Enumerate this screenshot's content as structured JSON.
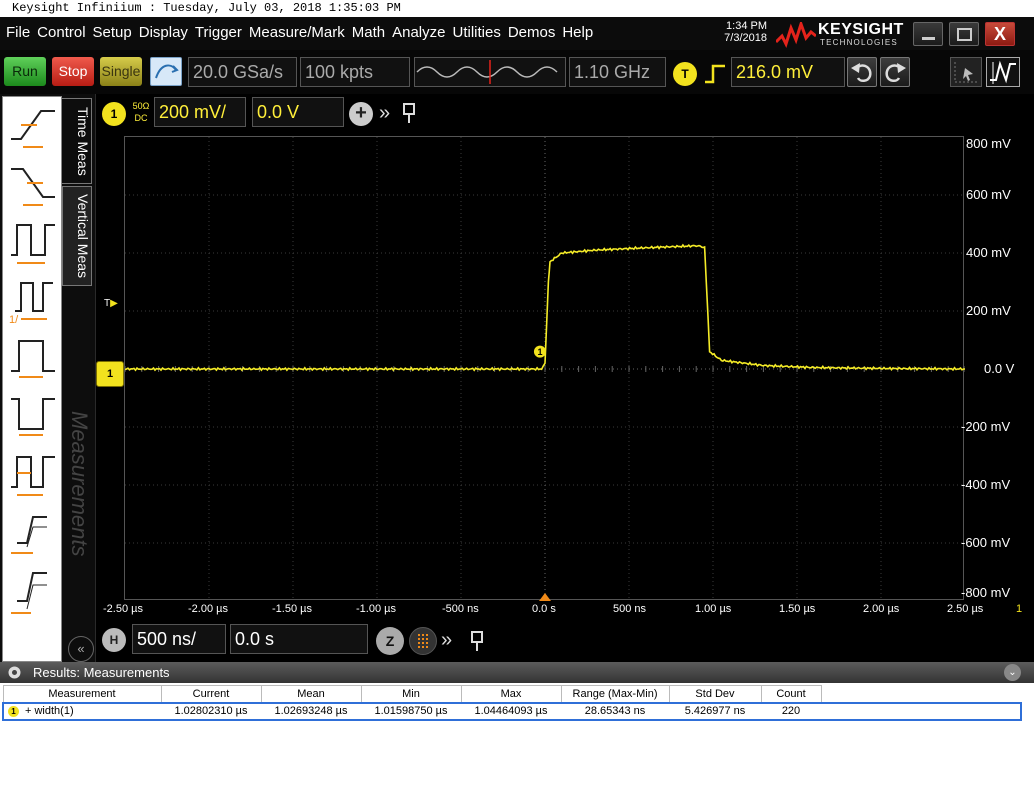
{
  "window": {
    "title": "Keysight Infiniium : Tuesday, July 03, 2018 1:35:03 PM"
  },
  "menu": [
    "File",
    "Control",
    "Setup",
    "Display",
    "Trigger",
    "Measure/Mark",
    "Math",
    "Analyze",
    "Utilities",
    "Demos",
    "Help"
  ],
  "clock": {
    "time": "1:34 PM",
    "date": "7/3/2018"
  },
  "brand": {
    "name": "KEYSIGHT",
    "sub": "TECHNOLOGIES"
  },
  "window_controls": {
    "close": "X"
  },
  "toolbar": {
    "run": "Run",
    "stop": "Stop",
    "single": "Single",
    "sample_rate": "20.0 GSa/s",
    "memory_depth": "100 kpts",
    "bandwidth": "1.10 GHz",
    "trigger_badge": "T",
    "trigger_level": "216.0 mV"
  },
  "left_tabs": {
    "time": "Time Meas",
    "vertical": "Vertical Meas",
    "watermark": "Measurements"
  },
  "channel": {
    "badge": "1",
    "coupling_1": "50Ω",
    "coupling_2": "DC",
    "scale": "200 mV/",
    "offset": "0.0 V"
  },
  "horizontal": {
    "badge": "H",
    "scale": "500 ns/",
    "position": "0.0 s",
    "zoom": "Z"
  },
  "y_axis": [
    "800 mV",
    "600 mV",
    "400 mV",
    "200 mV",
    "0.0 V",
    "-200 mV",
    "-400 mV",
    "-600 mV",
    "-800 mV"
  ],
  "x_axis": [
    "-2.50 µs",
    "-2.00 µs",
    "-1.50 µs",
    "-1.00 µs",
    "-500 ns",
    "0.0 s",
    "500 ns",
    "1.00 µs",
    "1.50 µs",
    "2.00 µs",
    "2.50 µs"
  ],
  "markers": {
    "trigger_marker": "T",
    "channel_marker": "1",
    "meas_marker": "1",
    "right_edge": "1"
  },
  "chart_data": {
    "type": "line",
    "xlim_us": [
      -2.5,
      2.5
    ],
    "ylim_mV": [
      -800,
      800
    ],
    "series": [
      {
        "x_us": [
          -2.5,
          -0.02,
          0.0,
          0.02,
          0.03,
          0.1,
          0.3,
          0.6,
          0.9,
          0.95,
          0.98,
          1.05,
          1.3,
          1.6,
          2.0,
          2.5
        ],
        "y_mV": [
          0,
          0,
          20,
          300,
          370,
          400,
          410,
          418,
          425,
          420,
          60,
          30,
          12,
          5,
          2,
          0
        ]
      }
    ],
    "grid": true,
    "color": "#f5ec27"
  },
  "results": {
    "title": "Results: Measurements",
    "columns": [
      "Measurement",
      "Current",
      "Mean",
      "Min",
      "Max",
      "Range (Max-Min)",
      "Std Dev",
      "Count"
    ],
    "rows": [
      [
        "+ width(1)",
        "1.02802310 µs",
        "1.02693248 µs",
        "1.01598750 µs",
        "1.04464093 µs",
        "28.65343 ns",
        "5.426977 ns",
        "220"
      ]
    ],
    "row_badge": "1"
  }
}
